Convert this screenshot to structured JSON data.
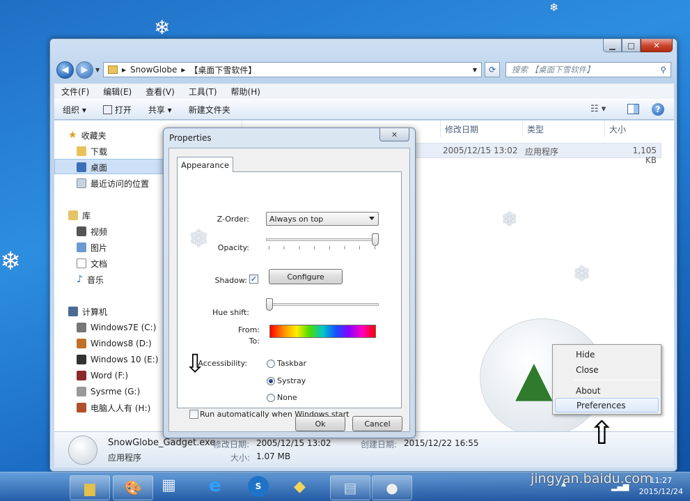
{
  "explorer": {
    "address": {
      "folder": "SnowGlobe",
      "sep": "▸",
      "breadcrumb": "【桌面下雪软件】"
    },
    "search_placeholder": "搜索 【桌面下雪软件】",
    "menu": [
      "文件(F)",
      "编辑(E)",
      "查看(V)",
      "工具(T)",
      "帮助(H)"
    ],
    "toolbar": {
      "organize": "组织 ▾",
      "open": "打开",
      "share": "共享 ▾",
      "new_folder": "新建文件夹"
    },
    "nav": {
      "favorites": "收藏夹",
      "fav_items": [
        "下载",
        "桌面",
        "最近访问的位置"
      ],
      "library": "库",
      "lib_items": [
        "视频",
        "图片",
        "文档",
        "音乐"
      ],
      "computer": "计算机",
      "drives": [
        "Windows7E (C:)",
        "Windows8 (D:)",
        "Windows 10 (E:)",
        "Word (F:)",
        "Sysrme (G:)",
        "电脑人人有 (H:)"
      ]
    },
    "columns": {
      "modified": "修改日期",
      "type": "类型",
      "size": "大小"
    },
    "file_row": {
      "modified": "2005/12/15 13:02",
      "type": "应用程序",
      "size": "1,105 KB"
    },
    "details": {
      "name": "SnowGlobe_Gadget.exe",
      "modified_label": "修改日期:",
      "modified": "2005/12/15 13:02",
      "created_label": "创建日期:",
      "created": "2015/12/22 16:55",
      "type": "应用程序",
      "size_label": "大小:",
      "size": "1.07 MB"
    }
  },
  "dialog": {
    "title": "Properties",
    "tab": "Appearance",
    "zorder_label": "Z-Order:",
    "zorder_value": "Always on top",
    "opacity_label": "Opacity:",
    "opacity_level": 1.0,
    "shadow_label": "Shadow:",
    "shadow_checked": true,
    "configure": "Configure",
    "hue_label": "Hue shift:",
    "hue_level": 0.0,
    "from_label": "From:",
    "to_label": "To:",
    "accessibility_label": "Accessibility:",
    "accessibility_options": [
      "Taskbar",
      "Systray",
      "None"
    ],
    "accessibility_selected": "Systray",
    "autorun_label": "Run automatically when Windows start",
    "autorun_checked": false,
    "ok": "Ok",
    "cancel": "Cancel"
  },
  "context_menu": {
    "items": [
      "Hide",
      "Close",
      "About",
      "Preferences"
    ],
    "highlighted": "Preferences"
  },
  "taskbar": {
    "time": "11:27",
    "date": "2015/12/24"
  },
  "watermark": "jingyan.baidu.com"
}
